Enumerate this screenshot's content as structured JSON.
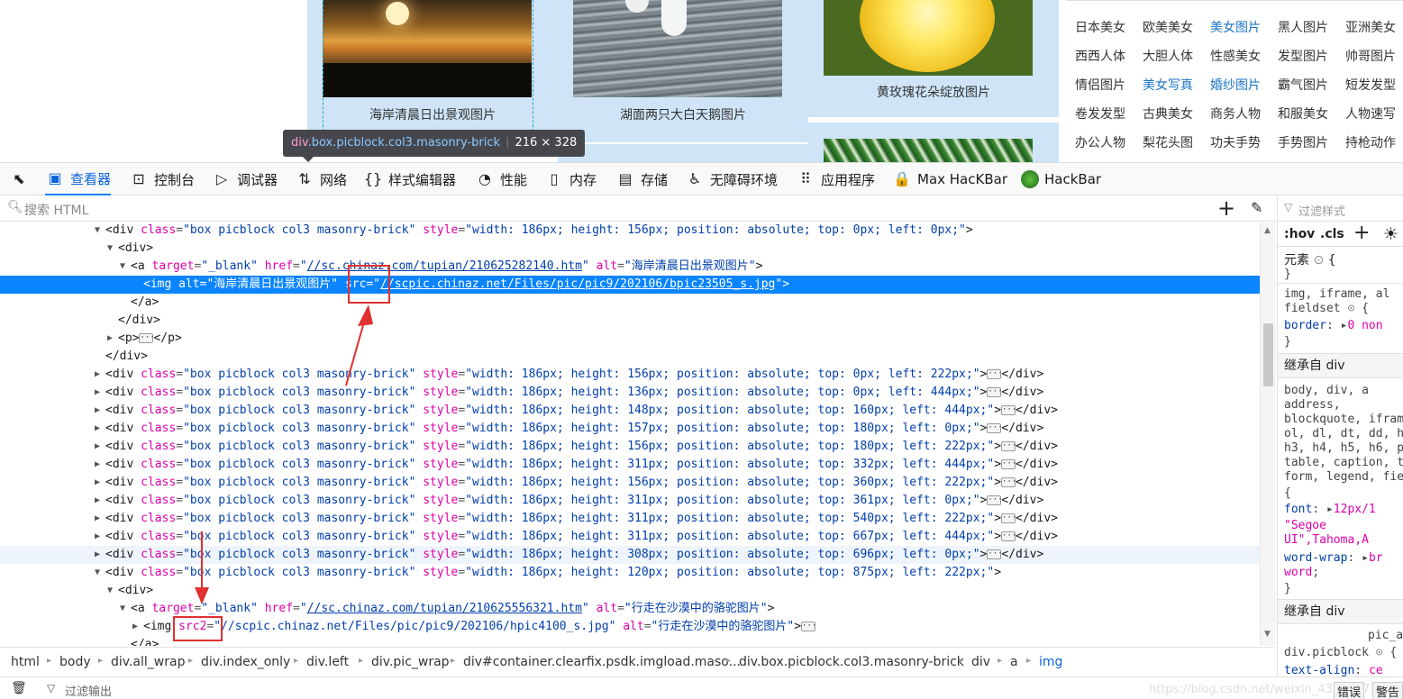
{
  "page": {
    "captions": [
      "海岸清晨日出景观图片",
      "湖面两只大白天鹅图片",
      "黄玫瑰花朵绽放图片"
    ],
    "tags": [
      [
        "日本美女",
        "欧美美女",
        "美女图片",
        "黑人图片",
        "亚洲美女"
      ],
      [
        "西西人体",
        "大胆人体",
        "性感美女",
        "发型图片",
        "帅哥图片"
      ],
      [
        "情侣图片",
        "美女写真",
        "婚纱图片",
        "霸气图片",
        "短发发型"
      ],
      [
        "卷发发型",
        "古典美女",
        "商务人物",
        "和服美女",
        "人物速写"
      ],
      [
        "办公人物",
        "梨花头图",
        "功夫手势",
        "手势图片",
        "持枪动作"
      ]
    ]
  },
  "tooltip": {
    "tag": "div",
    "classes": ".box.picblock.col3.masonry-brick",
    "size": "216 × 328"
  },
  "toolbar": {
    "tabs": [
      "查看器",
      "控制台",
      "调试器",
      "网络",
      "样式编辑器",
      "性能",
      "内存",
      "存储",
      "无障碍环境",
      "应用程序",
      "Max HacKBar",
      "HackBar"
    ],
    "active_tab": "查看器"
  },
  "search": {
    "placeholder": "搜索 HTML"
  },
  "tree": {
    "box_class": "box picblock col3 masonry-brick",
    "first_box_style": "width: 186px; height: 156px; position: absolute; top: 0px; left: 0px;",
    "a1_href": "//sc.chinaz.com/tupian/210625282140.htm",
    "a1_alt": "海岸清晨日出景观图片",
    "img1_alt": "海岸清晨日出景观图片",
    "img1_src": "//scpic.chinaz.net/Files/pic/pic9/202106/bpic23505_s.jpg",
    "collapsed_styles": [
      "width: 186px; height: 156px; position: absolute; top: 0px; left: 222px;",
      "width: 186px; height: 136px; position: absolute; top: 0px; left: 444px;",
      "width: 186px; height: 148px; position: absolute; top: 160px; left: 444px;",
      "width: 186px; height: 157px; position: absolute; top: 180px; left: 0px;",
      "width: 186px; height: 156px; position: absolute; top: 180px; left: 222px;",
      "width: 186px; height: 311px; position: absolute; top: 332px; left: 444px;",
      "width: 186px; height: 156px; position: absolute; top: 360px; left: 222px;",
      "width: 186px; height: 311px; position: absolute; top: 361px; left: 0px;",
      "width: 186px; height: 311px; position: absolute; top: 540px; left: 222px;",
      "width: 186px; height: 311px; position: absolute; top: 667px; left: 444px;",
      "width: 186px; height: 308px; position: absolute; top: 696px; left: 0px;"
    ],
    "last_box_style": "width: 186px; height: 120px; position: absolute; top: 875px; left: 222px;",
    "a2_href": "//sc.chinaz.com/tupian/210625556321.htm",
    "a2_alt": "行走在沙漠中的骆驼图片",
    "img2_src2": "//scpic.chinaz.net/Files/pic/pic9/202106/hpic4100_s.jpg",
    "img2_alt": "行走在沙漠中的骆驼图片"
  },
  "breadcrumb": [
    "html",
    "body",
    "div.all_wrap",
    "div.index_only",
    "div.left",
    "div.pic_wrap",
    "div#container.clearfix.psdk.imgload.maso...",
    "div.box.picblock.col3.masonry-brick",
    "div",
    "a",
    "img"
  ],
  "console": {
    "filter_label": "过滤输出",
    "errors": "错误",
    "warnings": "警告"
  },
  "rules": {
    "filter_placeholder": "过滤样式",
    "hov": ":hov",
    "cls": ".cls",
    "element_label": "元素",
    "inherit_label": "继承自 div",
    "pic_partial": "pic_a",
    "selector_picblock": "div.picblock"
  },
  "watermark": "https://blog.csdn.net/weixin_43332773"
}
